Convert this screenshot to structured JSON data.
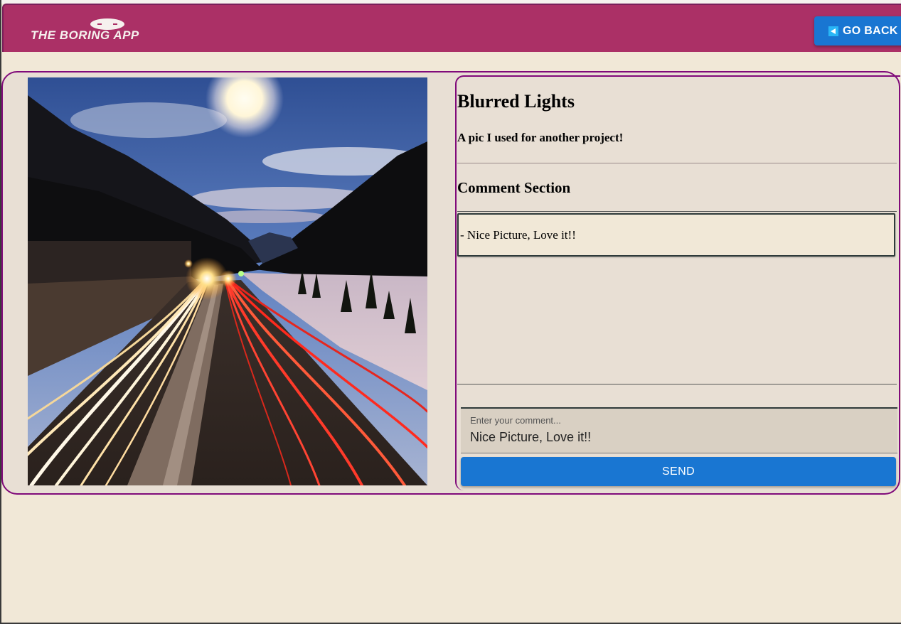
{
  "header": {
    "logo_text": "THE BORING APP",
    "back_label": "GO BACK",
    "back_icon": "back-arrow-icon",
    "colors": {
      "bar": "#ab3066",
      "button": "#1976d2"
    }
  },
  "post": {
    "title": "Blurred Lights",
    "description": "A pic I used for another project!",
    "image_subject": "long-exposure highway light trails between mountains at night"
  },
  "comments": {
    "heading": "Comment Section",
    "items": [
      {
        "text": "- Nice Picture, Love it!!"
      }
    ]
  },
  "comment_form": {
    "label": "Enter your comment...",
    "value": "Nice Picture, Love it!!",
    "send_label": "SEND"
  },
  "colors": {
    "background": "#f1e8d7",
    "card": "#e8dfd4",
    "card_border": "#800a7a"
  }
}
